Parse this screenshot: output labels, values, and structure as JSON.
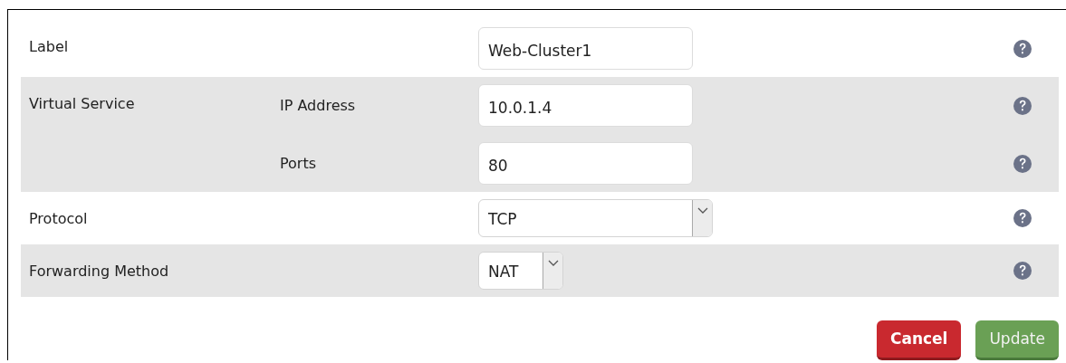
{
  "rows": [
    {
      "label": "Label",
      "fields": [
        {
          "kind": "text",
          "value": "Web-Cluster1"
        }
      ]
    },
    {
      "label": "Virtual Service",
      "fields": [
        {
          "kind": "text",
          "sublabel": "IP Address",
          "value": "10.0.1.4"
        },
        {
          "kind": "text",
          "sublabel": "Ports",
          "value": "80"
        }
      ]
    },
    {
      "label": "Protocol",
      "fields": [
        {
          "kind": "wideselect",
          "value": "TCP"
        }
      ]
    },
    {
      "label": "Forwarding Method",
      "fields": [
        {
          "kind": "select",
          "value": "NAT"
        }
      ]
    }
  ],
  "buttons": [
    {
      "kind": "cancel",
      "label": "Cancel"
    },
    {
      "kind": "update",
      "label": "Update"
    }
  ]
}
